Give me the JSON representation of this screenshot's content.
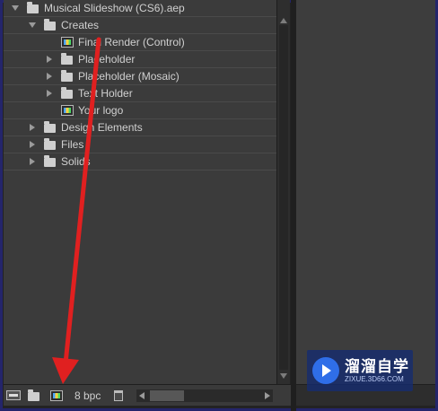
{
  "project": {
    "items": [
      {
        "label": "Musical Slideshow (CS6).aep",
        "type": "folder",
        "twirl": "down",
        "indent": 0
      },
      {
        "label": "Creates",
        "type": "folder",
        "twirl": "down",
        "indent": 1
      },
      {
        "label": "Final Render (Control)",
        "type": "comp",
        "twirl": "none",
        "indent": 2
      },
      {
        "label": "Placeholder",
        "type": "folder",
        "twirl": "right",
        "indent": 2
      },
      {
        "label": "Placeholder (Mosaic)",
        "type": "folder",
        "twirl": "right",
        "indent": 2
      },
      {
        "label": "Text Holder",
        "type": "folder",
        "twirl": "right",
        "indent": 2
      },
      {
        "label": "Your logo",
        "type": "comp",
        "twirl": "none",
        "indent": 2
      },
      {
        "label": "Design Elements",
        "type": "folder",
        "twirl": "right",
        "indent": 1
      },
      {
        "label": "Files",
        "type": "folder",
        "twirl": "right",
        "indent": 1
      },
      {
        "label": "Solids",
        "type": "folder",
        "twirl": "right",
        "indent": 1
      }
    ]
  },
  "bottom_bar": {
    "bpc_label": "8 bpc"
  },
  "watermark": {
    "title": "溜溜自学",
    "subtitle": "ZIXUE.3D66.COM"
  },
  "icons": {
    "interpret": "interpret-footage-icon",
    "folder": "new-folder-icon",
    "composition": "new-composition-icon",
    "trash": "trash-icon",
    "flowchart": "flowchart-icon"
  },
  "colors": {
    "panel_bg": "#3b3b3b",
    "annotation_arrow": "#e02020",
    "frame_border": "#24256b"
  }
}
